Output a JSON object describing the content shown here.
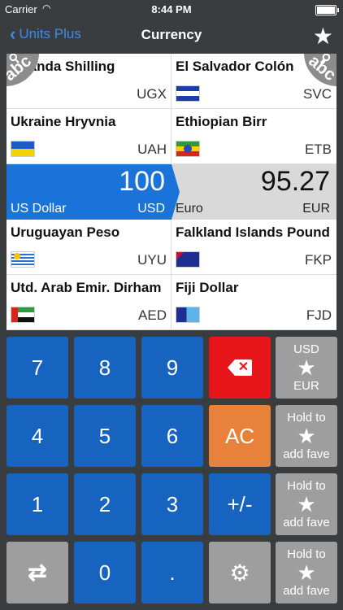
{
  "status": {
    "carrier": "Carrier",
    "time": "8:44 PM"
  },
  "nav": {
    "back_label": "Units Plus",
    "title": "Currency"
  },
  "currencies": [
    {
      "name": "Uganda Shilling",
      "code": "UGX"
    },
    {
      "name": "El Salvador Colón",
      "code": "SVC"
    },
    {
      "name": "Ukraine Hryvnia",
      "code": "UAH"
    },
    {
      "name": "Ethiopian Birr",
      "code": "ETB"
    },
    {
      "name": "Uruguayan Peso",
      "code": "UYU"
    },
    {
      "name": "Falkland Islands Pound",
      "code": "FKP"
    },
    {
      "name": "Utd. Arab Emir. Dirham",
      "code": "AED"
    },
    {
      "name": "Fiji Dollar",
      "code": "FJD"
    }
  ],
  "conversion": {
    "from": {
      "amount": "100",
      "name": "US Dollar",
      "code": "USD"
    },
    "to": {
      "amount": "95.27",
      "name": "Euro",
      "code": "EUR"
    }
  },
  "abc_label": "abc",
  "keys": {
    "k7": "7",
    "k8": "8",
    "k9": "9",
    "k4": "4",
    "k5": "5",
    "k6": "6",
    "k1": "1",
    "k2": "2",
    "k3": "3",
    "k0": "0",
    "dot": ".",
    "ac": "AC",
    "plusminus": "+/-"
  },
  "favorites": [
    {
      "top": "USD",
      "bottom": "EUR"
    },
    {
      "top": "Hold to",
      "bottom": "add fave"
    },
    {
      "top": "Hold to",
      "bottom": "add fave"
    },
    {
      "top": "Hold to",
      "bottom": "add fave"
    }
  ],
  "colors": {
    "accent": "#1a73d8",
    "backspace": "#e8151b",
    "ac": "#e8823a",
    "background": "#3a3d40"
  }
}
